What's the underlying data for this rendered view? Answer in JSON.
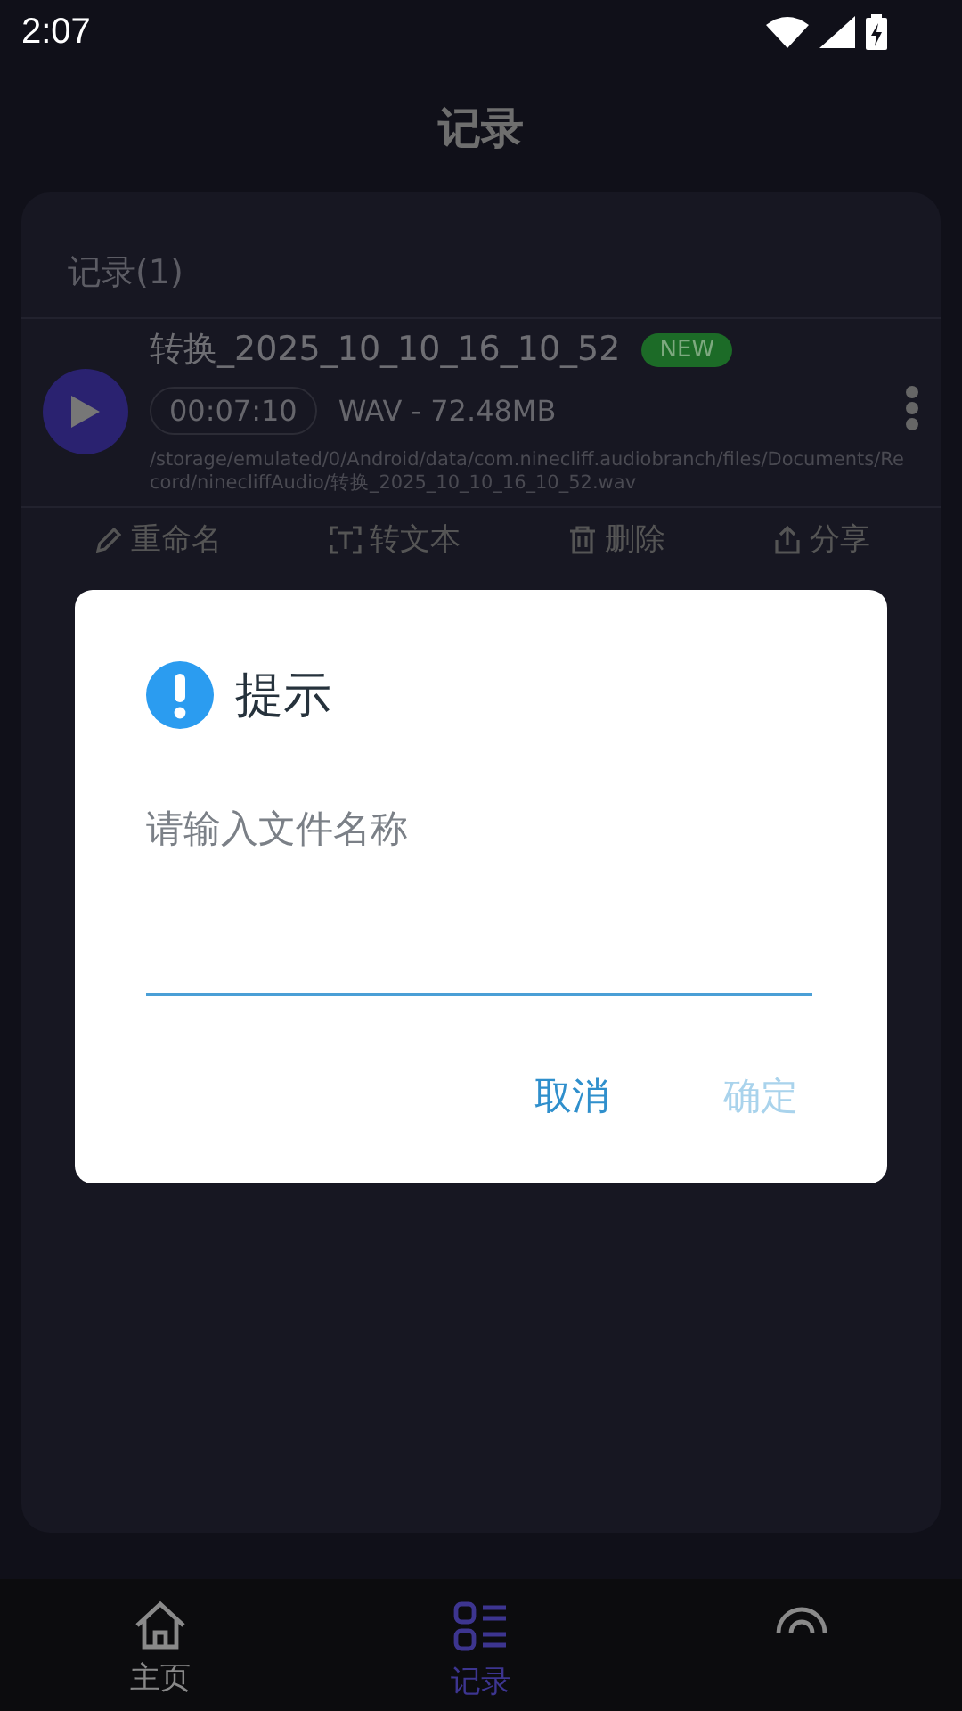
{
  "status_bar": {
    "time": "2:07"
  },
  "header": {
    "title": "记录"
  },
  "records": {
    "heading": "记录(1)",
    "items": [
      {
        "name": "转换_2025_10_10_16_10_52",
        "badge": "NEW",
        "duration": "00:07:10",
        "info": "WAV - 72.48MB",
        "path": "/storage/emulated/0/Android/data/com.ninecliff.audiobranch/files/Documents/Record/ninecliffAudio/转换_2025_10_10_16_10_52.wav",
        "actions": [
          {
            "kind": "rename",
            "label": "重命名"
          },
          {
            "kind": "text",
            "label": "转文本"
          },
          {
            "kind": "delete",
            "label": "删除"
          },
          {
            "kind": "share",
            "label": "分享"
          }
        ]
      }
    ]
  },
  "dialog": {
    "title": "提示",
    "message": "请输入文件名称",
    "buttons": [
      {
        "label": "取消",
        "disabled": false
      },
      {
        "label": "确定",
        "disabled": true
      }
    ]
  },
  "bottom_nav": [
    {
      "kind": "home",
      "label": "主页",
      "selected": false
    },
    {
      "kind": "list",
      "label": "记录",
      "selected": true
    },
    {
      "kind": "mic",
      "selected": false
    }
  ]
}
